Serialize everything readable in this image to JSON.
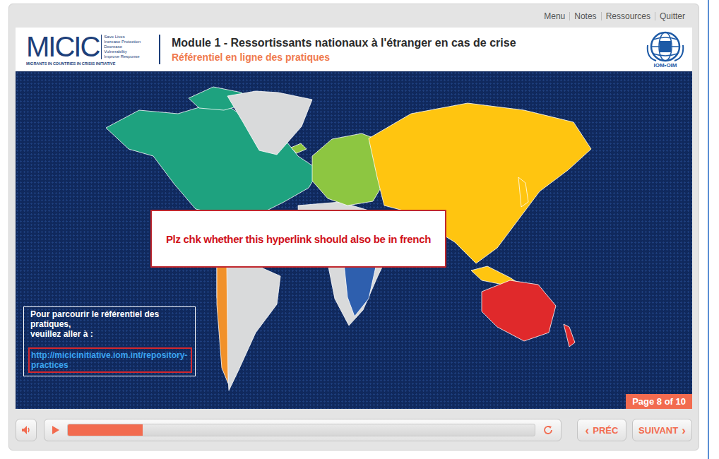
{
  "top_menu": [
    "Menu",
    "Notes",
    "Ressources",
    "Quitter"
  ],
  "header": {
    "logo": "MICIC",
    "logo_tagline": [
      "Save Lives",
      "Increase Protection",
      "Decrease Vulnerability",
      "Improve Response"
    ],
    "logo_subtitle": "MIGRANTS IN COUNTRIES IN CRISIS INITIATIVE",
    "title": "Module 1 - Ressortissants nationaux à l'étranger en cas de crise",
    "subtitle": "Référentiel en ligne des pratiques",
    "partner_logo": "IOM•OIM"
  },
  "map": {
    "regions": [
      {
        "color": "#1ea27f"
      },
      {
        "color": "#d9dadb"
      },
      {
        "color": "#8dc641"
      },
      {
        "color": "#ffc510"
      },
      {
        "color": "#e0292b"
      },
      {
        "color": "#f1912a"
      },
      {
        "color": "#2e5fae"
      }
    ]
  },
  "review_note": "Plz chk whether this hyperlink should also be in french",
  "info_box": {
    "lines": [
      "Pour parcourir le référentiel des pratiques,",
      "veuillez aller à :"
    ],
    "link": "http://micicinitiative.iom.int/repository-practices"
  },
  "page_badge": "Page 8 of 10",
  "player": {
    "progress": 0.16,
    "prev_icon": "‹",
    "prev": "PRÉC",
    "next": "SUIVANT",
    "next_icon": "›"
  }
}
